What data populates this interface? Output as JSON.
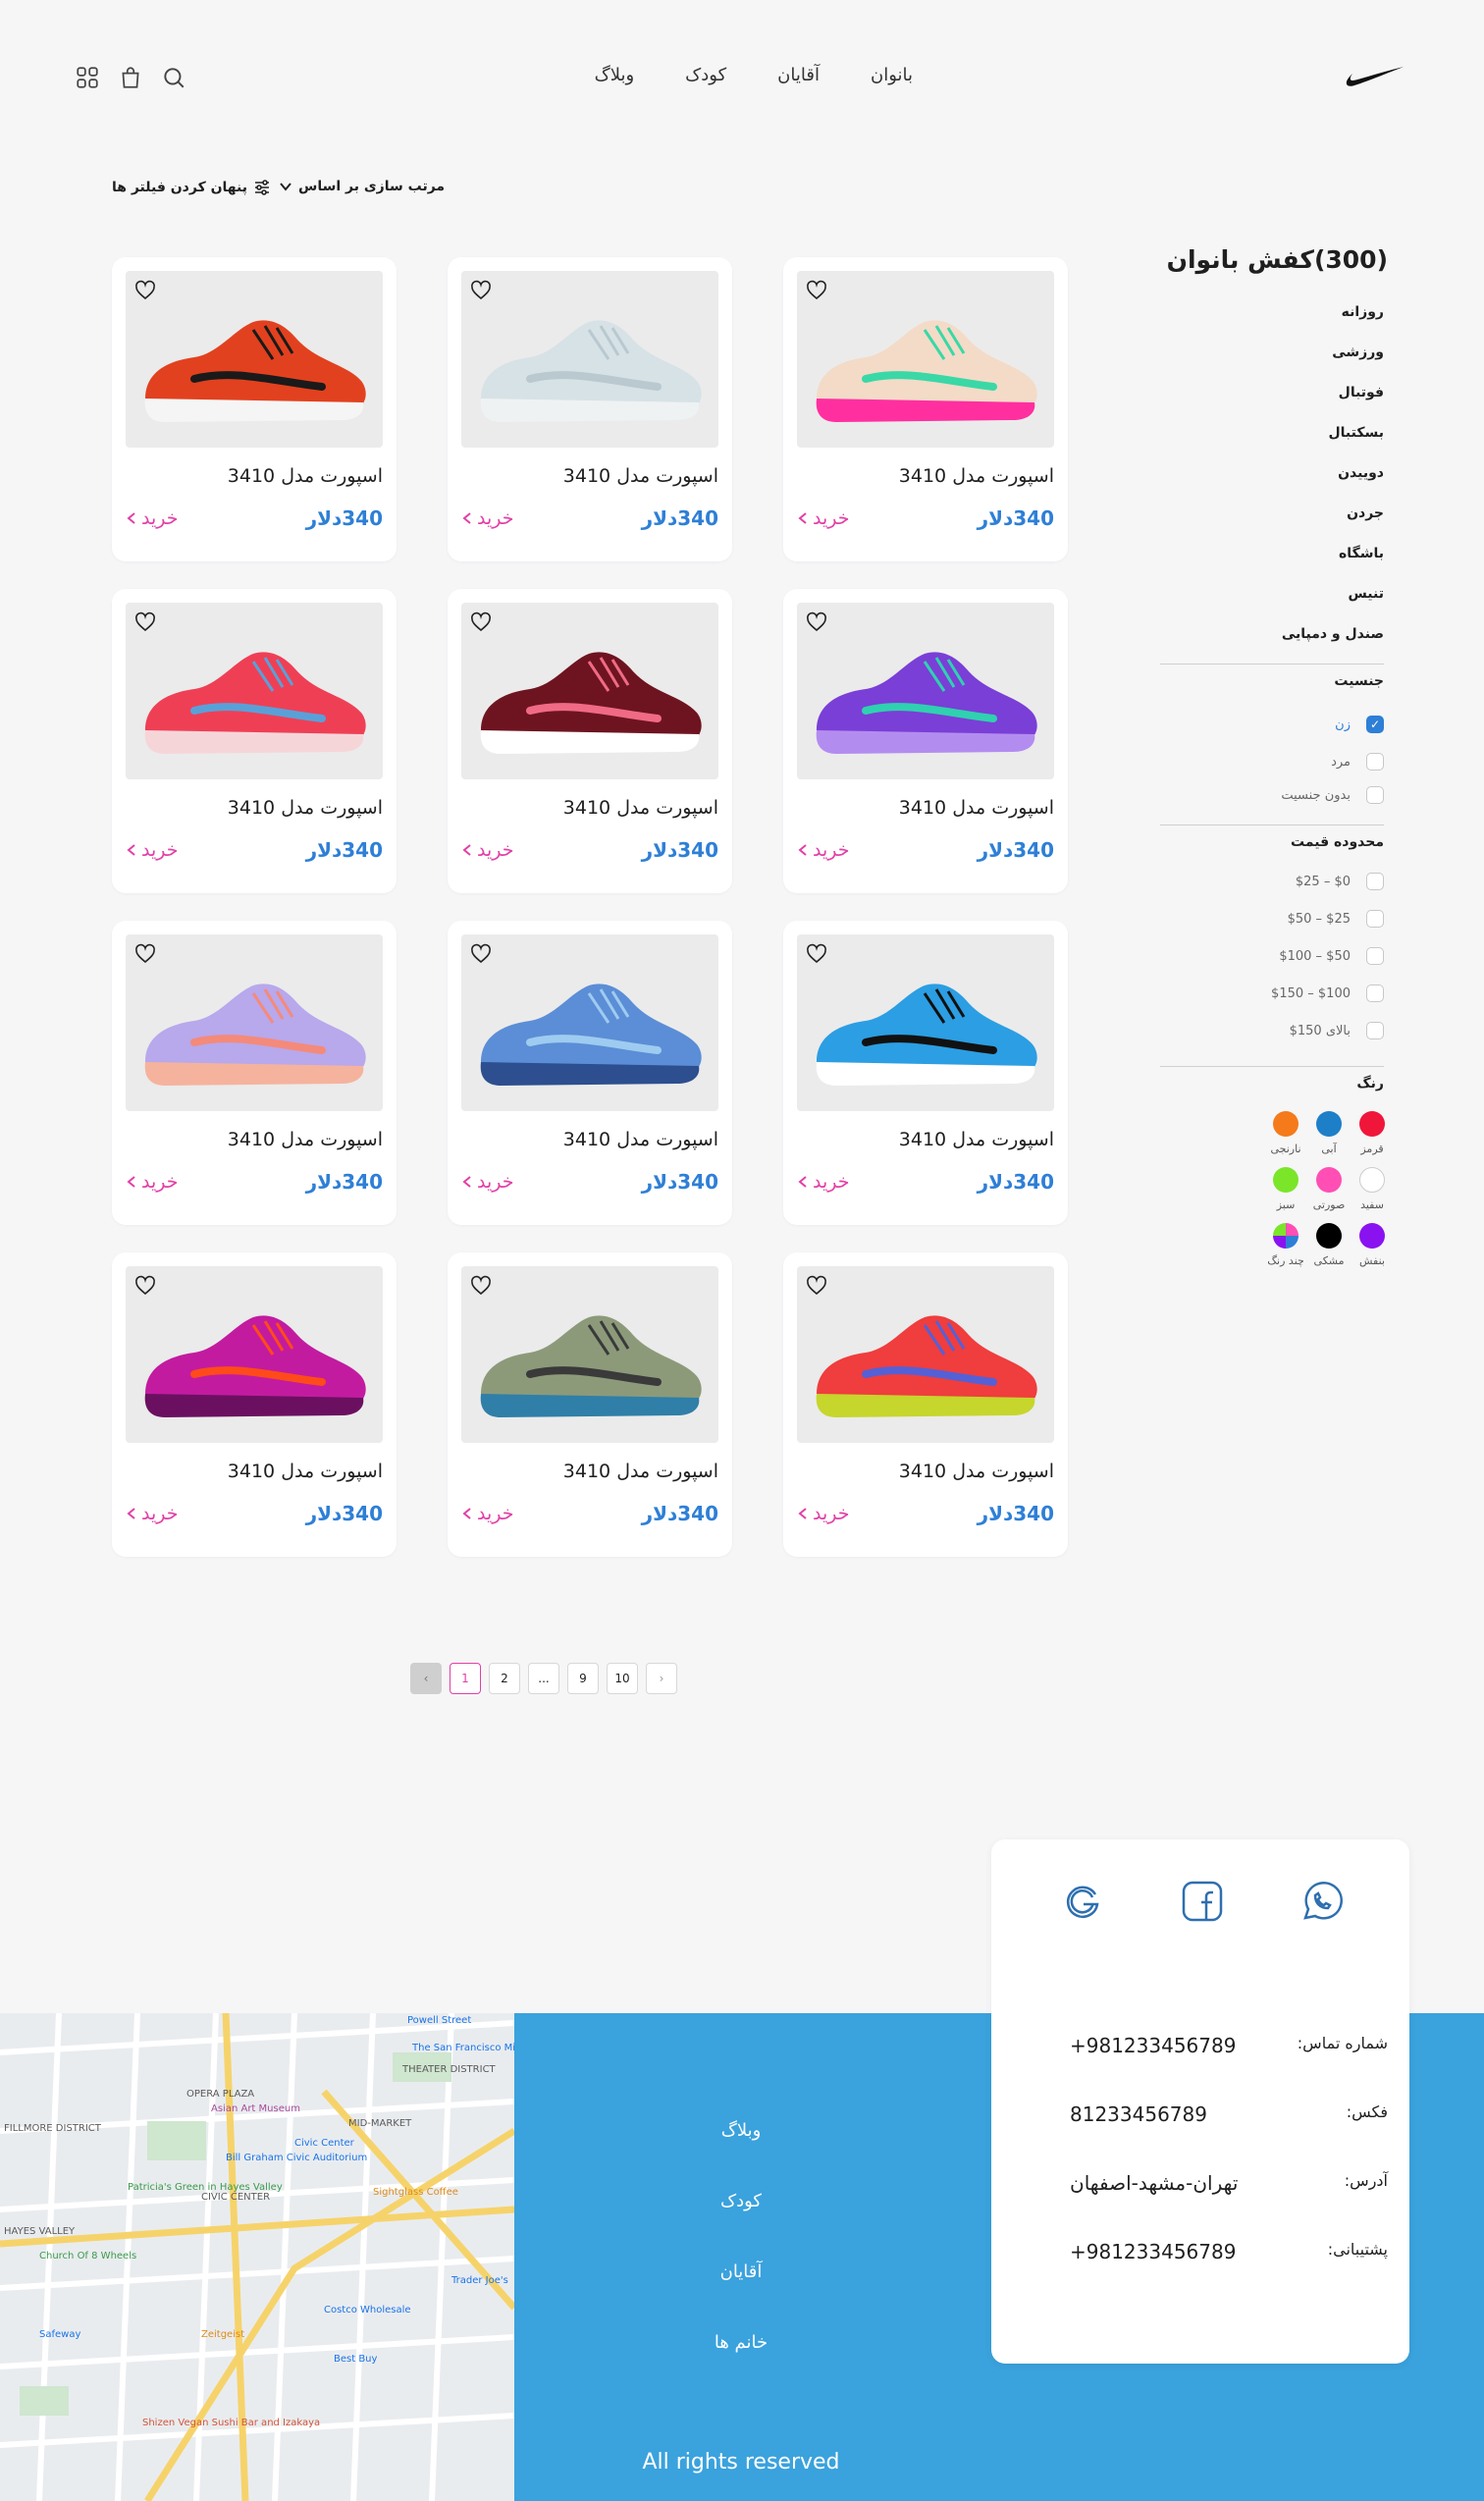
{
  "header": {
    "nav": [
      "بانوان",
      "آقایان",
      "کودک",
      "وبلاگ"
    ]
  },
  "toolbar": {
    "sort_label": "مرتب سازی بر اساس",
    "hide_filters": "پنهان کردن فیلتر ها"
  },
  "sidebar": {
    "title": "(300)کفش بانوان",
    "categories": [
      "روزانه",
      "ورزشی",
      "فوتبال",
      "بسکتبال",
      "دوییدن",
      "جردن",
      "باشگاه",
      "تنیس",
      "صندل و دمپایی"
    ],
    "gender": {
      "title": "جنسیت",
      "options": [
        {
          "label": "زن",
          "checked": true
        },
        {
          "label": "مرد",
          "checked": false
        },
        {
          "label": "بدون جنسیت",
          "checked": false
        }
      ]
    },
    "price": {
      "title": "محدوده قیمت",
      "options": [
        "$0 – $25",
        "$25 – $50",
        "$50 – $100",
        "$100 – $150",
        "بالای 150$"
      ]
    },
    "color": {
      "title": "رنگ",
      "options": [
        {
          "label": "قرمز",
          "hex": "#f0163a"
        },
        {
          "label": "آبی",
          "hex": "#1e7fc9"
        },
        {
          "label": "نارنجی",
          "hex": "#f57a1a"
        },
        {
          "label": "سفید",
          "hex": "#ffffff"
        },
        {
          "label": "صورتی",
          "hex": "#ff4fb4"
        },
        {
          "label": "سبز",
          "hex": "#7be52a"
        },
        {
          "label": "بنفش",
          "hex": "#8a12f0"
        },
        {
          "label": "مشکی",
          "hex": "#000000"
        },
        {
          "label": "چند رنگ",
          "hex": "multi"
        }
      ]
    }
  },
  "products": [
    {
      "name": "اسپورت مدل 3410",
      "price": "340دلار",
      "buy": "خرید",
      "colors": [
        "#f3dbc7",
        "#3ad8a6",
        "#ff2fa0"
      ]
    },
    {
      "name": "اسپورت مدل 3410",
      "price": "340دلار",
      "buy": "خرید",
      "colors": [
        "#d7e2e6",
        "#b9c9cf",
        "#eef2f3"
      ]
    },
    {
      "name": "اسپورت مدل 3410",
      "price": "340دلار",
      "buy": "خرید",
      "colors": [
        "#e2411f",
        "#1a1a1a",
        "#f5f5f5"
      ]
    },
    {
      "name": "اسپورت مدل 3410",
      "price": "340دلار",
      "buy": "خرید",
      "colors": [
        "#7a3fd6",
        "#2fd1b0",
        "#b38cf0"
      ]
    },
    {
      "name": "اسپورت مدل 3410",
      "price": "340دلار",
      "buy": "خرید",
      "colors": [
        "#6e1420",
        "#f06a86",
        "#ffffff"
      ]
    },
    {
      "name": "اسپورت مدل 3410",
      "price": "340دلار",
      "buy": "خرید",
      "colors": [
        "#ef3f55",
        "#5aa0d8",
        "#f6d5d9"
      ]
    },
    {
      "name": "اسپورت مدل 3410",
      "price": "340دلار",
      "buy": "خرید",
      "colors": [
        "#2c9ee3",
        "#111111",
        "#ffffff"
      ]
    },
    {
      "name": "اسپورت مدل 3410",
      "price": "340دلار",
      "buy": "خرید",
      "colors": [
        "#5b8ed6",
        "#9ecbf0",
        "#2d4f8f"
      ]
    },
    {
      "name": "اسپورت مدل 3410",
      "price": "340دلار",
      "buy": "خرید",
      "colors": [
        "#b8a8ec",
        "#f48a7a",
        "#f5b39e"
      ]
    },
    {
      "name": "اسپورت مدل 3410",
      "price": "340دلار",
      "buy": "خرید",
      "colors": [
        "#f03d3d",
        "#5560d6",
        "#c6d62c"
      ]
    },
    {
      "name": "اسپورت مدل 3410",
      "price": "340دلار",
      "buy": "خرید",
      "colors": [
        "#8c9a7a",
        "#3a3a3a",
        "#2f7fa8"
      ]
    },
    {
      "name": "اسپورت مدل 3410",
      "price": "340دلار",
      "buy": "خرید",
      "colors": [
        "#c21ba0",
        "#ff4a1a",
        "#6b1060"
      ]
    }
  ],
  "pagination": [
    "1",
    "2",
    "...",
    "9",
    "10"
  ],
  "footer": {
    "links": [
      "وبلاگ",
      "کودک",
      "آقایان",
      "خانم ها"
    ],
    "rights": "All rights reserved",
    "contact": [
      {
        "label": "شماره تماس:",
        "value": "+981233456789"
      },
      {
        "label": "فکس:",
        "value": "81233456789"
      },
      {
        "label": "آدرس:",
        "value": "تهران-مشهد-اصفهان"
      },
      {
        "label": "پشتیبانی:",
        "value": "+981233456789"
      }
    ],
    "map_labels": [
      "OPERA PLAZA",
      "Asian Art Museum",
      "MID-MARKET",
      "THEATER DISTRICT",
      "FILLMORE DISTRICT",
      "CIVIC CENTER",
      "HAYES VALLEY",
      "Bill Graham Civic Auditorium",
      "Patricia's Green in Hayes Valley",
      "Civic Center",
      "Sightglass Coffee",
      "The San Francisco Mint",
      "Church Of 8 Wheels",
      "Zeitgeist",
      "Costco Wholesale",
      "Best Buy",
      "Trader Joe's",
      "Shizen Vegan Sushi Bar and Izakaya",
      "Safeway",
      "Powell Street"
    ]
  },
  "accent": {
    "blue": "#2e7fd6",
    "pink": "#e23fa6",
    "footer": "#3aa2dd"
  }
}
